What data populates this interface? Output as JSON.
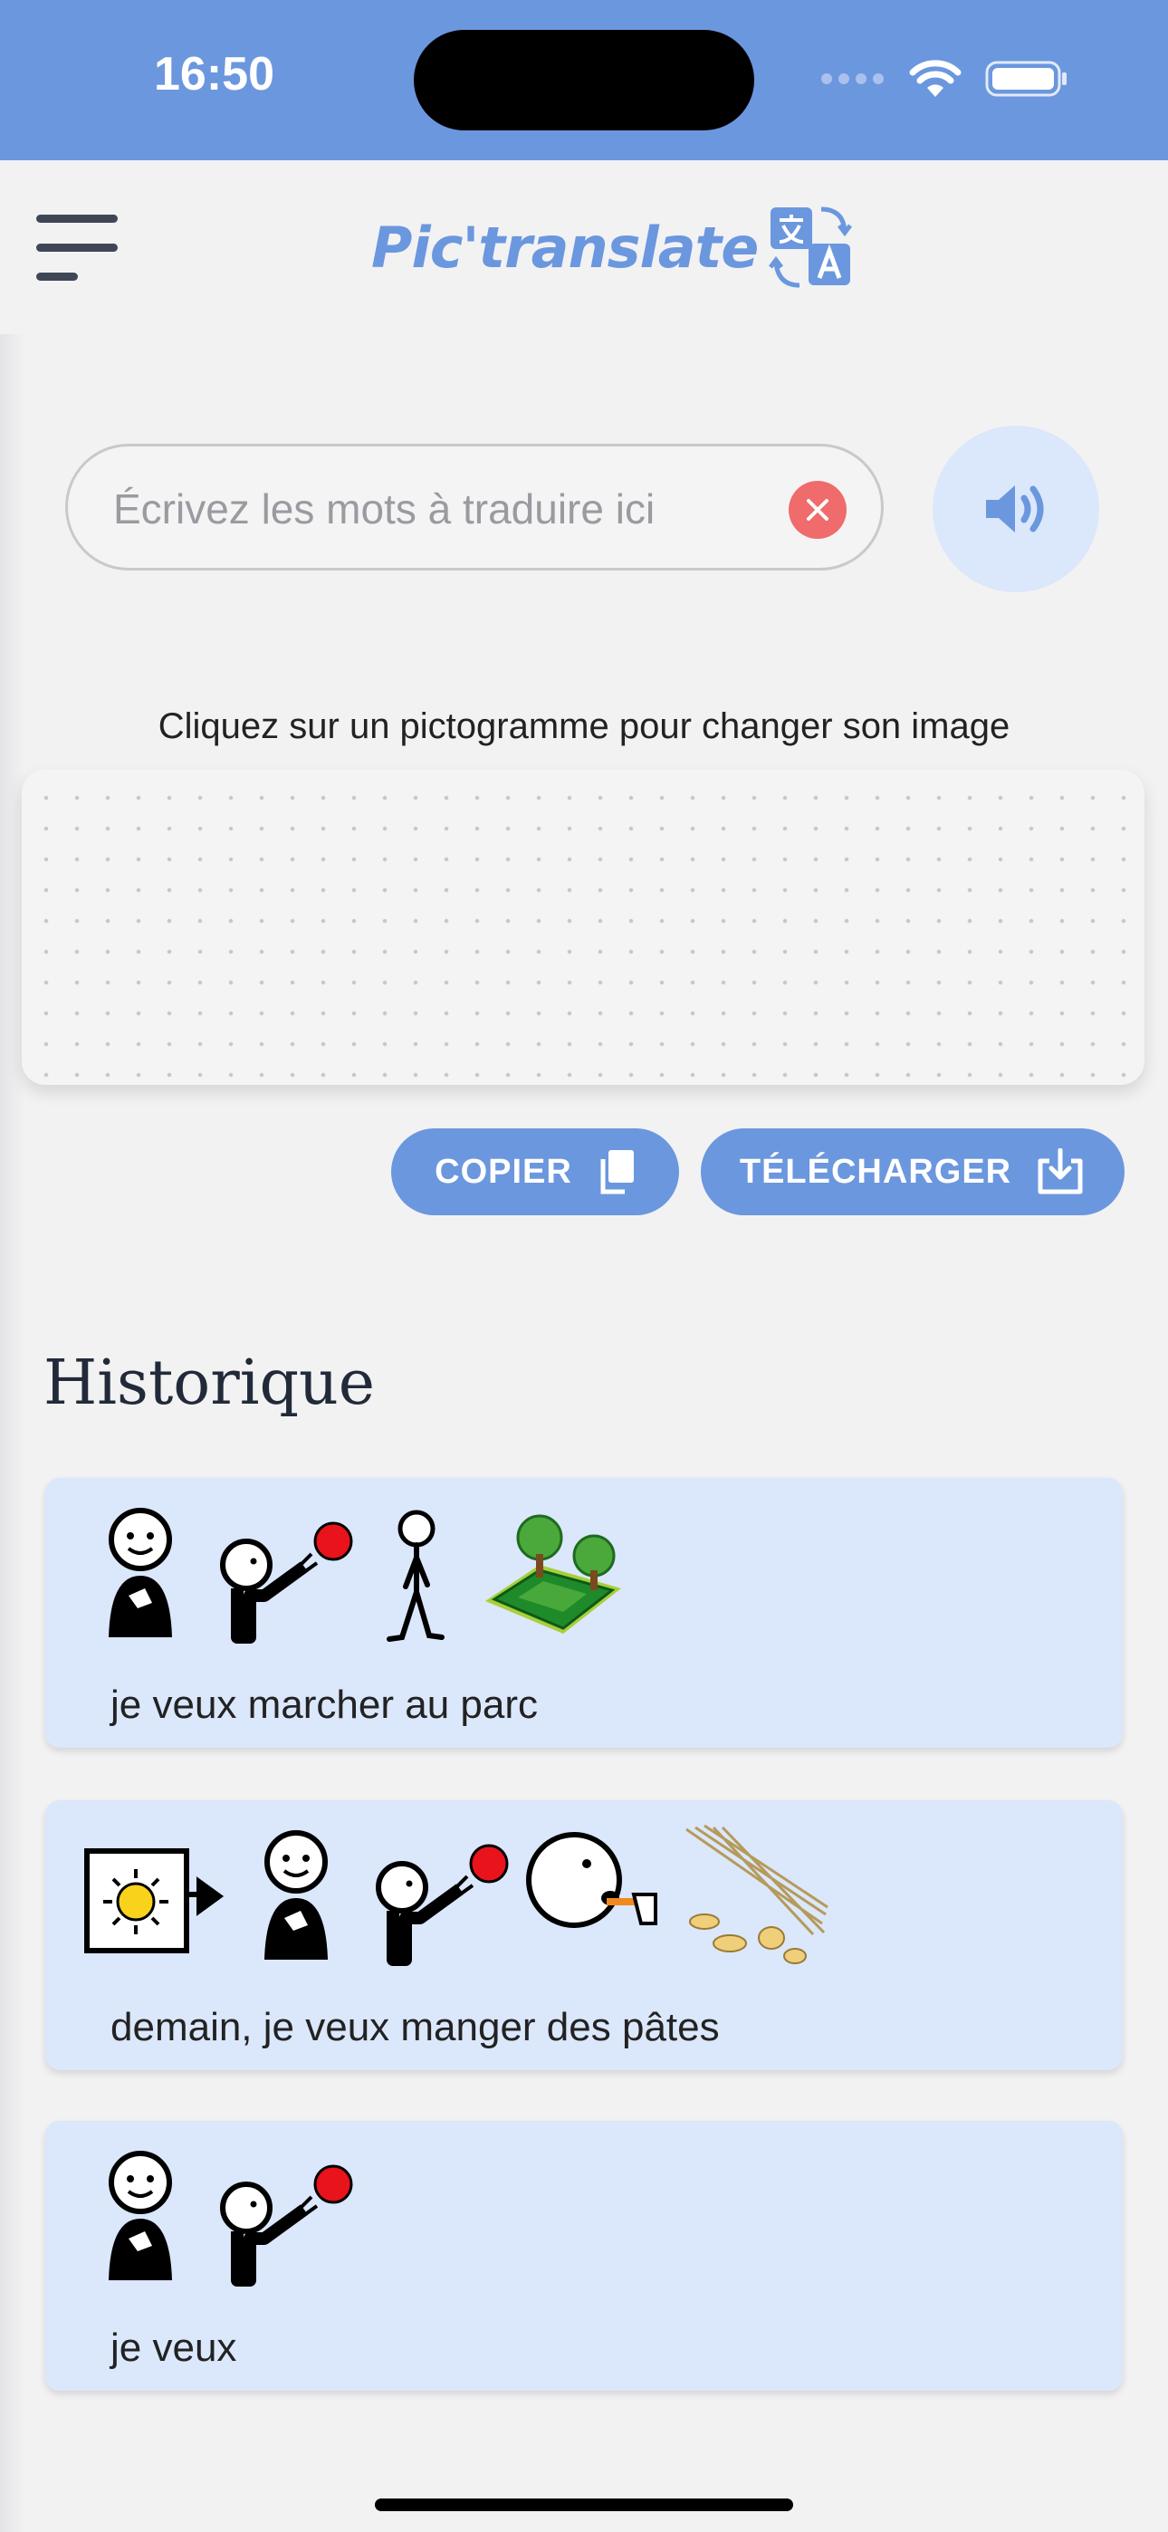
{
  "status_bar": {
    "time": "16:50"
  },
  "app_bar": {
    "title": "Pic'translate"
  },
  "search": {
    "placeholder": "Écrivez les mots à traduire ici",
    "value": ""
  },
  "hint_text": "Cliquez sur un pictogramme pour changer son image",
  "actions": {
    "copy_label": "COPIER",
    "download_label": "TÉLÉCHARGER"
  },
  "history": {
    "title": "Historique",
    "items": [
      {
        "text": "je veux marcher au parc",
        "pictograms": [
          "person-me-icon",
          "want-icon",
          "walk-icon",
          "park-icon"
        ]
      },
      {
        "text": "demain, je veux manger des pâtes",
        "pictograms": [
          "tomorrow-icon",
          "person-me-icon",
          "want-icon",
          "eat-icon",
          "pasta-icon"
        ]
      },
      {
        "text": "je veux",
        "pictograms": [
          "person-me-icon",
          "want-icon"
        ]
      }
    ]
  },
  "colors": {
    "accent": "#6b97de",
    "card_bg": "#dbe7fb",
    "clear": "#f06b6b"
  }
}
